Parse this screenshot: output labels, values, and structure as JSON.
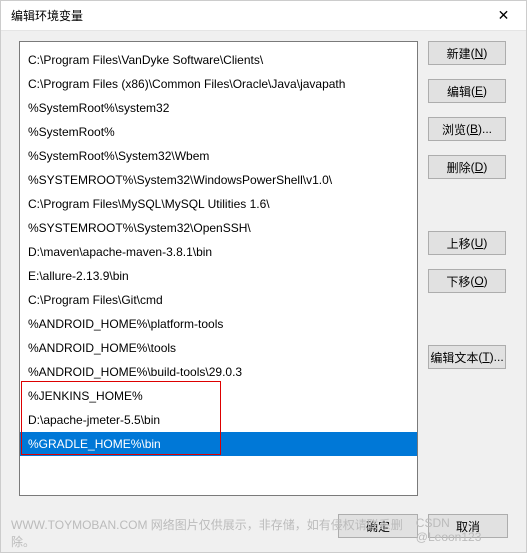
{
  "title": "编辑环境变量",
  "items": [
    "C:\\Program Files\\VanDyke Software\\Clients\\",
    "C:\\Program Files (x86)\\Common Files\\Oracle\\Java\\javapath",
    "%SystemRoot%\\system32",
    "%SystemRoot%",
    "%SystemRoot%\\System32\\Wbem",
    "%SYSTEMROOT%\\System32\\WindowsPowerShell\\v1.0\\",
    "C:\\Program Files\\MySQL\\MySQL Utilities 1.6\\",
    "%SYSTEMROOT%\\System32\\OpenSSH\\",
    "D:\\maven\\apache-maven-3.8.1\\bin",
    "E:\\allure-2.13.9\\bin",
    "C:\\Program Files\\Git\\cmd",
    "%ANDROID_HOME%\\platform-tools",
    "%ANDROID_HOME%\\tools",
    "%ANDROID_HOME%\\build-tools\\29.0.3",
    "%JENKINS_HOME%",
    "D:\\apache-jmeter-5.5\\bin",
    "%GRADLE_HOME%\\bin"
  ],
  "selected_index": 16,
  "buttons": {
    "new": {
      "label": "新建",
      "mn": "N"
    },
    "edit": {
      "label": "编辑",
      "mn": "E"
    },
    "browse": {
      "label": "浏览",
      "mn": "B",
      "suffix": "..."
    },
    "delete": {
      "label": "删除",
      "mn": "D"
    },
    "up": {
      "label": "上移",
      "mn": "U"
    },
    "down": {
      "label": "下移",
      "mn": "O"
    },
    "edit_text": {
      "label": "编辑文本",
      "mn": "T",
      "suffix": "..."
    },
    "ok": "确定",
    "cancel": "取消"
  },
  "watermark_left": "WWW.TOYMOBAN.COM  网络图片仅供展示，非存储，如有侵权请联系删除。",
  "watermark_right": "CSDN @Leoon123"
}
